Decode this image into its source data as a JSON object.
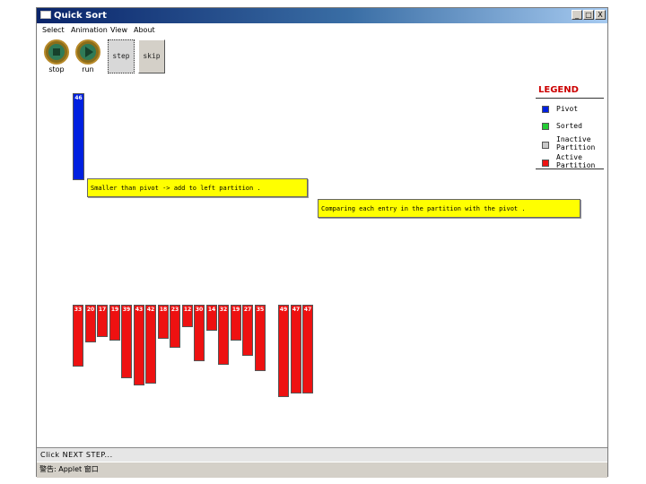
{
  "window": {
    "title": "Quick Sort"
  },
  "titlebar_buttons": [
    "_",
    "□",
    "X"
  ],
  "menu": [
    "Select",
    "Animation",
    "View",
    "About"
  ],
  "toolbar": {
    "stop_label": "stop",
    "run_label": "run",
    "step_label": "step",
    "skip_label": "skip"
  },
  "pivot": {
    "value": "46",
    "color": "#0020e0"
  },
  "messages": {
    "left": "Smaller than pivot -> add to left partition .",
    "right": "Comparing each entry in the partition with the pivot ."
  },
  "legend": {
    "title": "LEGEND",
    "items": [
      {
        "label": "Pivot",
        "color": "#0020e0"
      },
      {
        "label": "Sorted",
        "color": "#22cc33"
      },
      {
        "label": "Inactive Partition",
        "color": "#c8c8c8"
      },
      {
        "label": "Active Partition",
        "color": "#ee1111"
      }
    ]
  },
  "chart_data": {
    "type": "bar",
    "pivot": 46,
    "values": [
      33,
      20,
      17,
      19,
      39,
      43,
      42,
      18,
      23,
      12,
      30,
      14,
      32,
      19,
      27,
      35,
      49,
      47,
      47
    ],
    "active_color": "#ee1111"
  },
  "status": {
    "text": "Click NEXT STEP..."
  },
  "warning": {
    "text": "警告: Applet 窗口"
  }
}
